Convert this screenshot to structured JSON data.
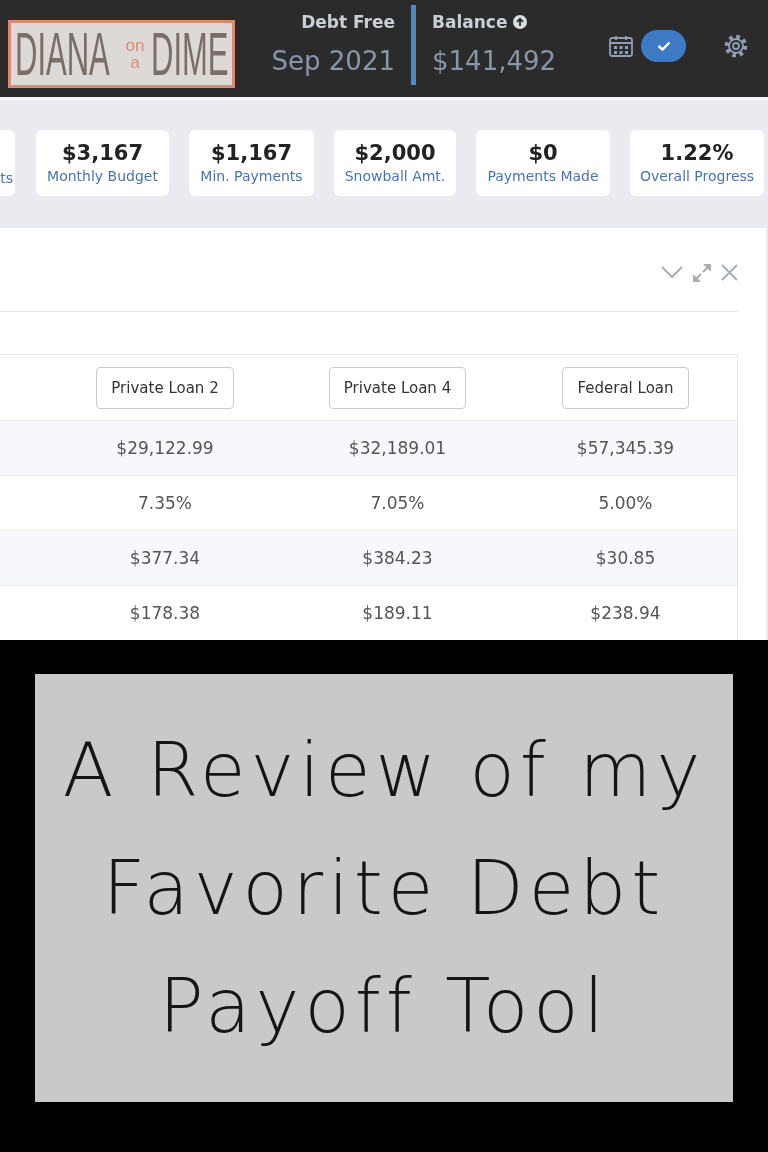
{
  "header": {
    "logo": {
      "word_1": "DIANA",
      "small_top": "on",
      "small_bottom": "a",
      "word_2": "DIME"
    },
    "debt_free": {
      "label": "Debt Free",
      "value": "Sep 2021"
    },
    "balance": {
      "label": "Balance",
      "value": "$141,492"
    }
  },
  "stats": [
    {
      "label": "ts"
    },
    {
      "value": "$3,167",
      "label": "Monthly Budget"
    },
    {
      "value": "$1,167",
      "label": "Min. Payments"
    },
    {
      "value": "$2,000",
      "label": "Snowball Amt."
    },
    {
      "value": "$0",
      "label": "Payments Made"
    },
    {
      "value": "1.22%",
      "label": "Overall Progress"
    }
  ],
  "panel": {
    "table": {
      "columns": [
        "Private Loan 2",
        "Private Loan 4",
        "Federal Loan"
      ],
      "rows": [
        [
          "$29,122.99",
          "$32,189.01",
          "$57,345.39"
        ],
        [
          "7.35%",
          "7.05%",
          "5.00%"
        ],
        [
          "$377.34",
          "$384.23",
          "$30.85"
        ],
        [
          "$178.38",
          "$189.11",
          "$238.94"
        ]
      ]
    }
  },
  "title_card": {
    "lines": [
      "A Review of my",
      "Favorite Debt",
      "Payoff Tool"
    ]
  }
}
